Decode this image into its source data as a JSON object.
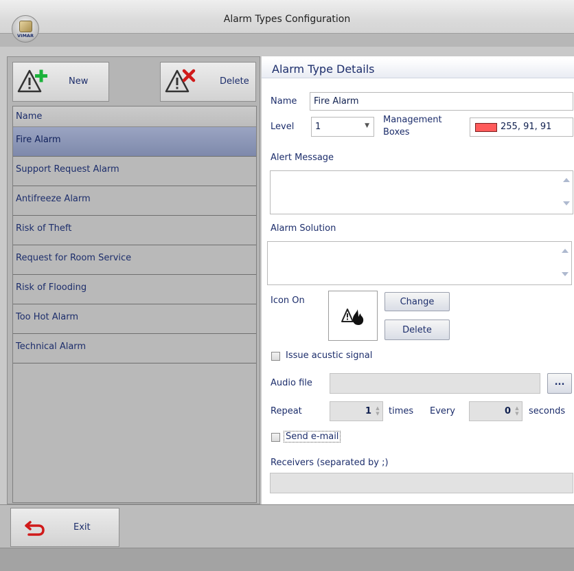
{
  "window": {
    "title": "Alarm Types Configuration",
    "logo_text": "VIMAR"
  },
  "toolbar": {
    "new_label": "New",
    "delete_label": "Delete"
  },
  "list": {
    "header": "Name",
    "items": [
      {
        "label": "Fire Alarm",
        "selected": true
      },
      {
        "label": "Support Request Alarm"
      },
      {
        "label": "Antifreeze Alarm"
      },
      {
        "label": "Risk of Theft"
      },
      {
        "label": "Request for Room Service"
      },
      {
        "label": "Risk of Flooding"
      },
      {
        "label": "Too Hot Alarm"
      },
      {
        "label": "Technical Alarm"
      }
    ]
  },
  "details": {
    "header": "Alarm Type Details",
    "name_label": "Name",
    "name_value": "Fire Alarm",
    "level_label": "Level",
    "level_value": "1",
    "management_label_1": "Management",
    "management_label_2": "Boxes",
    "color_value": "255, 91, 91",
    "color_hex": "#ff5b5b",
    "alert_message_label": "Alert Message",
    "alert_message_value": "",
    "alarm_solution_label": "Alarm Solution",
    "alarm_solution_value": "",
    "icon_on_label": "Icon On",
    "icon_name": "fire-alarm-icon",
    "change_label": "Change",
    "delete_icon_label": "Delete",
    "acoustic_label": "Issue acustic signal",
    "acoustic_checked": false,
    "audio_file_label": "Audio file",
    "audio_file_value": "",
    "browse_label": "...",
    "repeat_label": "Repeat",
    "repeat_value": "1",
    "times_label": "times",
    "every_label": "Every",
    "every_value": "0",
    "seconds_label": "seconds",
    "send_email_label": "Send e-mail",
    "send_email_checked": false,
    "receivers_label": "Receivers (separated by ;)",
    "receivers_value": ""
  },
  "footer": {
    "exit_label": "Exit"
  }
}
